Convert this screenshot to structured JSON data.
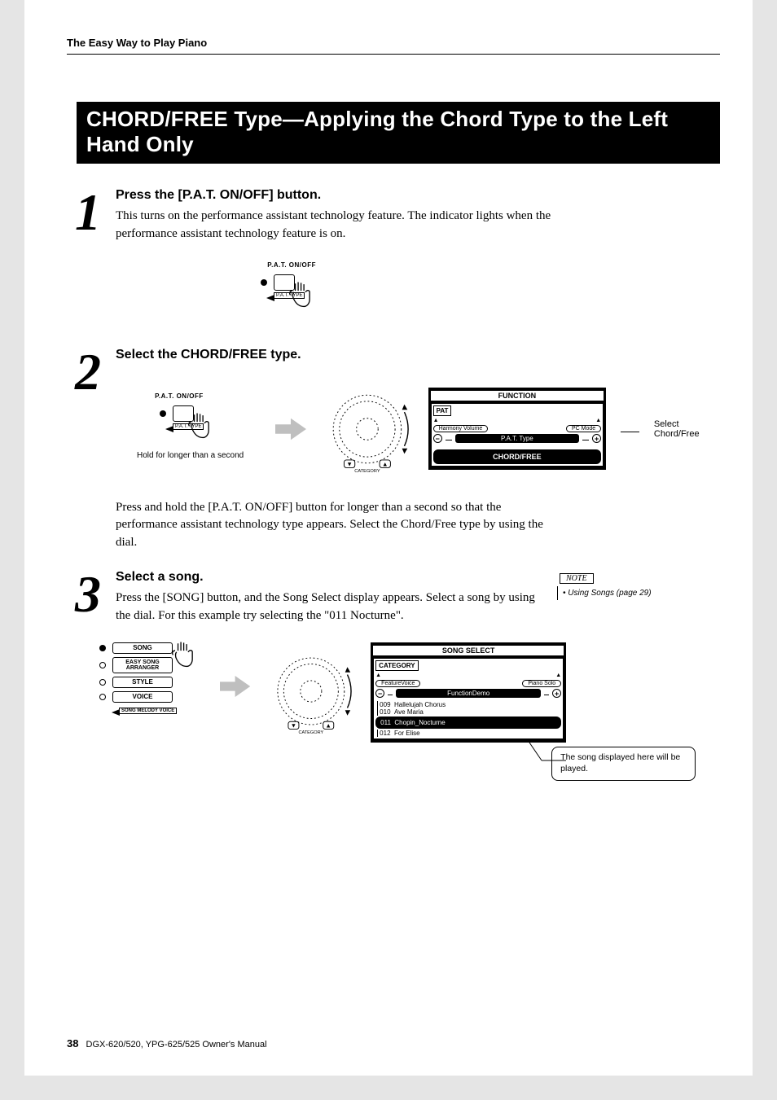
{
  "header": {
    "breadcrumb": "The Easy Way to Play Piano"
  },
  "section_title": "CHORD/FREE Type—Applying the Chord Type to the Left Hand Only",
  "steps": [
    {
      "num": "1",
      "title": "Press the [P.A.T. ON/OFF] button.",
      "body": "This turns on the performance assistant technology feature.\nThe indicator lights when the performance assistant technology feature is on.",
      "diagram": {
        "pat_top": "P.A.T. ON/OFF",
        "pat_flag": "P.A.T. TYPE"
      }
    },
    {
      "num": "2",
      "title": "Select the CHORD/FREE type.",
      "diagram": {
        "pat_top": "P.A.T. ON/OFF",
        "pat_flag": "P.A.T. TYPE",
        "hold_text": "Hold for longer than a second",
        "dial_label": "CATEGORY",
        "lcd": {
          "title": "FUNCTION",
          "tag": "PAT",
          "pill_left": "Harmony Volume",
          "pill_right": "PC Mode",
          "bar_label": "P.A.T. Type",
          "select": "CHORD/FREE"
        },
        "callout": "Select Chord/Free"
      },
      "body_after": "Press and hold the [P.A.T. ON/OFF] button for longer than a second so that the performance assistant technology type appears. Select the Chord/Free type by using the dial."
    },
    {
      "num": "3",
      "title": "Select a song.",
      "body": "Press the [SONG] button, and the Song Select display appears. Select a song by using the dial. For this example try selecting the \"011 Nocturne\".",
      "note": {
        "label": "NOTE",
        "text": "• Using Songs (page 29)"
      },
      "diagram": {
        "song_buttons": [
          "SONG",
          "EASY SONG\nARRANGER",
          "STYLE",
          "VOICE"
        ],
        "song_flag": "SONG MELODY VOICE",
        "dial_label": "CATEGORY",
        "lcd": {
          "title": "SONG SELECT",
          "tag": "CATEGORY",
          "pill_left": "FeatureVoice",
          "pill_right": "Piano Solo",
          "bar_label": "FunctionDemo",
          "list": [
            {
              "id": "009",
              "name": "Hallelujah Chorus",
              "dotted": true
            },
            {
              "id": "010",
              "name": "Ave Maria"
            },
            {
              "id": "011",
              "name": "Chopin_Nocturne",
              "selected": true
            },
            {
              "id": "012",
              "name": "For Elise"
            }
          ]
        },
        "callout_box": "The song displayed here will be played."
      }
    }
  ],
  "footer": {
    "page": "38",
    "text": "DGX-620/520, YPG-625/525  Owner's Manual"
  }
}
